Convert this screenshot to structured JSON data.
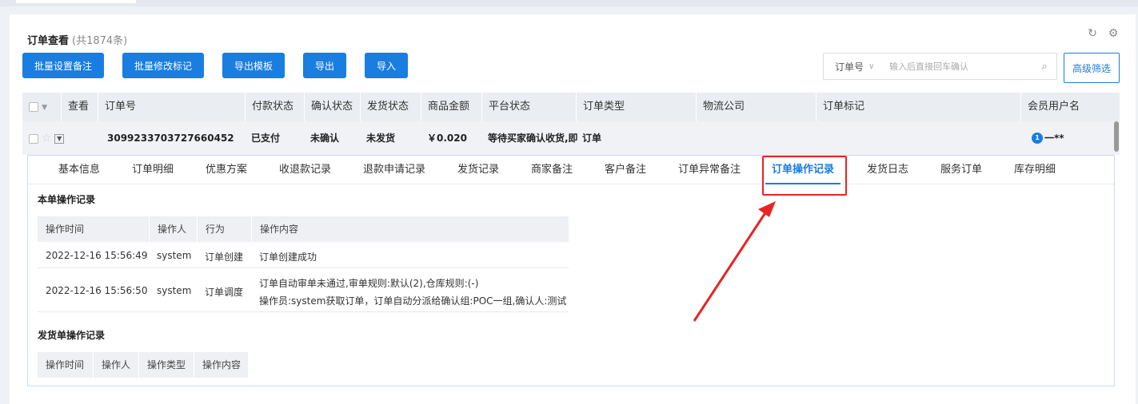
{
  "header": {
    "title": "订单查看",
    "count": "(共1874条)"
  },
  "toolbar": {
    "buttons": [
      "批量设置备注",
      "批量修改标记",
      "导出模板",
      "导出",
      "导入"
    ],
    "search_field": "订单号",
    "search_placeholder": "输入后直接回车确认",
    "advanced": "高级筛选"
  },
  "table": {
    "columns": [
      "查看",
      "订单号",
      "付款状态",
      "确认状态",
      "发货状态",
      "商品金额",
      "平台状态",
      "订单类型",
      "物流公司",
      "订单标记",
      "会员用户名"
    ],
    "row1": {
      "order_no": "3099233703727660452",
      "pay": "已支付",
      "confirm": "未确认",
      "ship": "未发货",
      "amount": "￥0.020",
      "platform": "等待买家确认收货,即:",
      "type": "订单",
      "member_badge": "1",
      "member": "一**"
    }
  },
  "detail": {
    "tabs": [
      "基本信息",
      "订单明细",
      "优惠方案",
      "收退款记录",
      "退款申请记录",
      "发货记录",
      "商家备注",
      "客户备注",
      "订单异常备注",
      "订单操作记录",
      "发货日志",
      "服务订单",
      "库存明细"
    ],
    "section1_title": "本单操作记录",
    "log_columns": [
      "操作时间",
      "操作人",
      "行为",
      "操作内容"
    ],
    "log_rows": [
      {
        "time": "2022-12-16 15:56:49",
        "user": "system",
        "action": "订单创建",
        "content1": "订单创建成功",
        "content2": ""
      },
      {
        "time": "2022-12-16 15:56:50",
        "user": "system",
        "action": "订单调度",
        "content1": "订单自动审单未通过,审单规则:默认(2),仓库规则:(-)",
        "content2": "操作员:system获取订单，订单自动分派给确认组:POC一组,确认人:测试"
      }
    ],
    "section2_title": "发货单操作记录",
    "ship_columns": [
      "操作时间",
      "操作人",
      "操作类型",
      "操作内容"
    ]
  },
  "colors": {
    "primary": "#1a7de0",
    "highlight": "#e82424"
  }
}
